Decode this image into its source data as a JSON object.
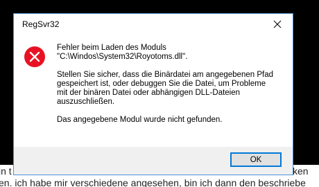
{
  "window": {
    "title": "RegSvr32"
  },
  "message": {
    "paragraph1": [
      "Fehler beim Laden des Moduls",
      "\"C:\\Windos\\System32\\Royotoms.dll\"."
    ],
    "paragraph2": [
      "Stellen Sie sicher, dass die Binärdatei am angegebenen Pfad",
      "gespeichert ist, oder debuggen Sie die Datei, um Probleme",
      "mit der binären Datei oder abhängigen DLL-Dateien",
      "auszuschließen."
    ],
    "paragraph3": [
      "Das angegebene Modul wurde nicht gefunden."
    ]
  },
  "buttons": {
    "ok_label": "OK"
  },
  "background": {
    "line1_start": "in t",
    "line1_end": "ken",
    "line2": "en. ich habe mir verschiedene angesehen, bin ich dann den beschriebe"
  },
  "colors": {
    "error_icon": "#e81123",
    "dialog_border": "#4a8fd8",
    "button_border": "#0078d7",
    "footer_bg": "#f0f0f0"
  },
  "icons": {
    "error": "error-icon",
    "close": "close-icon"
  }
}
